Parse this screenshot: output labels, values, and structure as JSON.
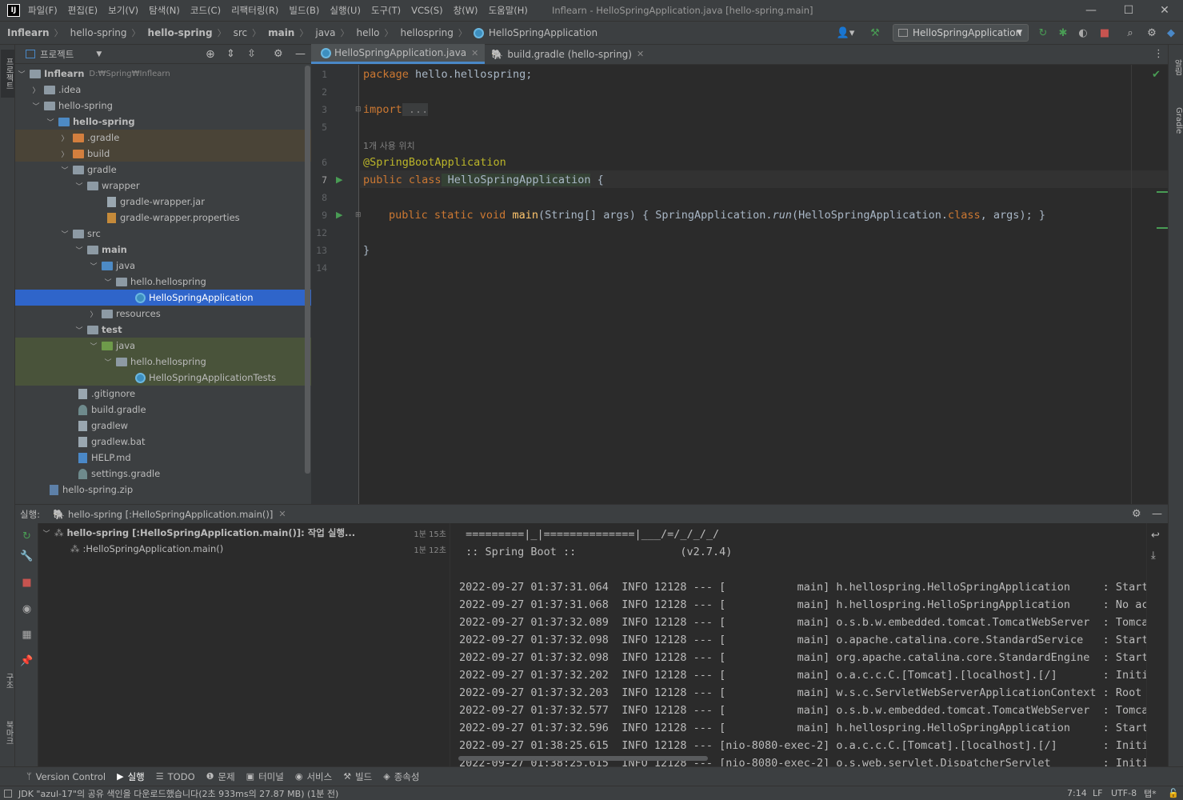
{
  "window": {
    "app_logo": "IJ",
    "menu": [
      "파일(F)",
      "편집(E)",
      "보기(V)",
      "탐색(N)",
      "코드(C)",
      "리팩터링(R)",
      "빌드(B)",
      "실행(U)",
      "도구(T)",
      "VCS(S)",
      "창(W)",
      "도움말(H)"
    ],
    "title": "Inflearn - HelloSpringApplication.java [hello-spring.main]"
  },
  "navbar": {
    "breadcrumbs": [
      "Inflearn",
      "hello-spring",
      "hello-spring",
      "src",
      "main",
      "java",
      "hello",
      "hellospring",
      "HelloSpringApplication"
    ],
    "run_config": "HelloSpringApplication"
  },
  "left_strip": {
    "project_label": "프로젝트",
    "structure_label": "구조",
    "bookmarks_label": "북마크"
  },
  "right_strip": {
    "notifications_label": "알림",
    "gradle_label": "Gradle"
  },
  "project": {
    "header": "프로젝트",
    "root_path": "D:₩Spring₩Inflearn",
    "tree": [
      {
        "label": "Inflearn",
        "bold": true
      },
      {
        "label": ".idea"
      },
      {
        "label": "hello-spring"
      },
      {
        "label": "hello-spring",
        "bold": true
      },
      {
        "label": ".gradle"
      },
      {
        "label": "build"
      },
      {
        "label": "gradle"
      },
      {
        "label": "wrapper"
      },
      {
        "label": "gradle-wrapper.jar"
      },
      {
        "label": "gradle-wrapper.properties"
      },
      {
        "label": "src"
      },
      {
        "label": "main"
      },
      {
        "label": "java"
      },
      {
        "label": "hello.hellospring"
      },
      {
        "label": "HelloSpringApplication",
        "selected": true
      },
      {
        "label": "resources"
      },
      {
        "label": "test"
      },
      {
        "label": "java"
      },
      {
        "label": "hello.hellospring"
      },
      {
        "label": "HelloSpringApplicationTests"
      },
      {
        "label": ".gitignore"
      },
      {
        "label": "build.gradle"
      },
      {
        "label": "gradlew"
      },
      {
        "label": "gradlew.bat"
      },
      {
        "label": "HELP.md"
      },
      {
        "label": "settings.gradle"
      },
      {
        "label": "hello-spring.zip"
      }
    ]
  },
  "editor": {
    "tabs": [
      {
        "label": "HelloSpringApplication.java",
        "active": true
      },
      {
        "label": "build.gradle (hello-spring)",
        "active": false
      }
    ],
    "line_numbers": [
      "1",
      "2",
      "3",
      "5",
      "6",
      "7",
      "8",
      "9",
      "12",
      "13",
      "14"
    ],
    "usage_hint": "1개 사용 위치",
    "code": {
      "package_kw": "package",
      "package_name": " hello.hellospring;",
      "import_kw": "import",
      "import_fold": " ...",
      "annotation": "@SpringBootApplication",
      "class_decl_kw": "public class",
      "class_name": " HelloSpringApplication",
      "class_brace": " {",
      "method_kw": "public static void",
      "method_name": " main",
      "method_sig": "(String[] args) { SpringApplication.",
      "method_run": "run",
      "method_args_open": "(HelloSpringApplication.",
      "method_class_kw": "class",
      "method_args_close": ", args); }",
      "close_brace": "}"
    }
  },
  "run_panel": {
    "label": "실행:",
    "tab": "hello-spring [:HelloSpringApplication.main()]",
    "tree": [
      {
        "label": "hello-spring [:HelloSpringApplication.main()]: 작업 실행...",
        "time": "1분 15초"
      },
      {
        "label": ":HelloSpringApplication.main()",
        "time": "1분 12초"
      }
    ],
    "console": [
      " =========|_|==============|___/=/_/_/_/",
      " :: Spring Boot ::                (v2.7.4)",
      "",
      "2022-09-27 01:37:31.064  INFO 12128 --- [           main] h.hellospring.HelloSpringApplication     : Starting",
      "2022-09-27 01:37:31.068  INFO 12128 --- [           main] h.hellospring.HelloSpringApplication     : No active",
      "2022-09-27 01:37:32.089  INFO 12128 --- [           main] o.s.b.w.embedded.tomcat.TomcatWebServer  : Tomcat in",
      "2022-09-27 01:37:32.098  INFO 12128 --- [           main] o.apache.catalina.core.StandardService   : Starting",
      "2022-09-27 01:37:32.098  INFO 12128 --- [           main] org.apache.catalina.core.StandardEngine  : Starting",
      "2022-09-27 01:37:32.202  INFO 12128 --- [           main] o.a.c.c.C.[Tomcat].[localhost].[/]       : Initiali",
      "2022-09-27 01:37:32.203  INFO 12128 --- [           main] w.s.c.ServletWebServerApplicationContext : Root Web",
      "2022-09-27 01:37:32.577  INFO 12128 --- [           main] o.s.b.w.embedded.tomcat.TomcatWebServer  : Tomcat st",
      "2022-09-27 01:37:32.596  INFO 12128 --- [           main] h.hellospring.HelloSpringApplication     : Started",
      "2022-09-27 01:38:25.615  INFO 12128 --- [nio-8080-exec-2] o.a.c.c.C.[Tomcat].[localhost].[/]       : Initiali",
      "2022-09-27 01:38:25.615  INFO 12128 --- [nio-8080-exec-2] o.s.web.servlet.DispatcherServlet        : Initiali"
    ]
  },
  "bottom_tabs": [
    "Version Control",
    "실행",
    "TODO",
    "문제",
    "터미널",
    "서비스",
    "빌드",
    "종속성"
  ],
  "status": {
    "message": "JDK \"azul-17\"의 공유 색인을 다운로드했습니다(2초 933ms의 27.87 MB) (1분 전)",
    "position": "7:14",
    "line_sep": "LF",
    "encoding": "UTF-8",
    "indent": "탭*"
  },
  "colors": {
    "accent": "#4a88c7",
    "selected_row": "#2f65ca",
    "keyword": "#cc7832",
    "annotation": "#bbb529",
    "method": "#ffc66d",
    "run_green": "#499c54"
  }
}
